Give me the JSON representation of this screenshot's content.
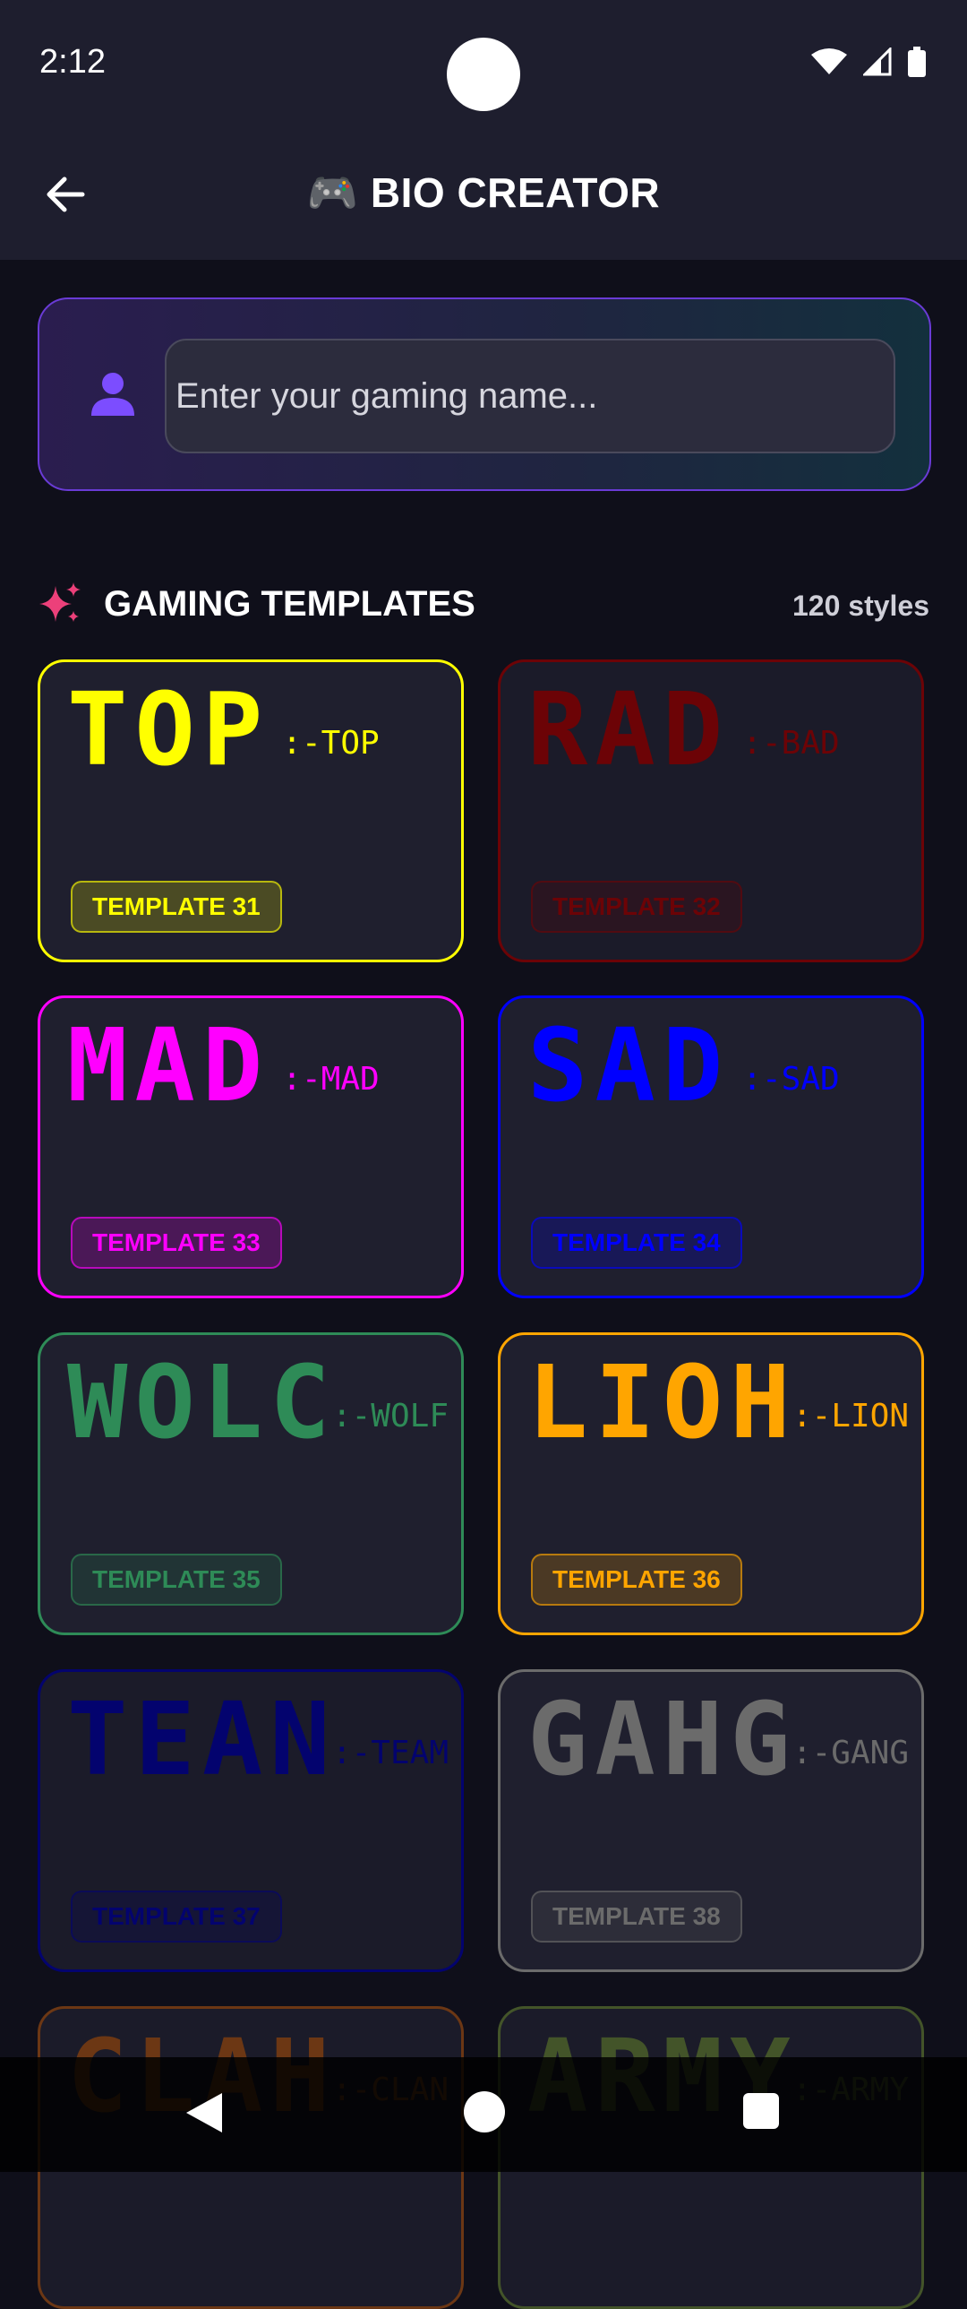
{
  "status": {
    "time": "2:12"
  },
  "appbar": {
    "title": "🎮 BIO CREATOR"
  },
  "name_input": {
    "placeholder": "Enter your gaming name..."
  },
  "section": {
    "title": "GAMING TEMPLATES",
    "count": "120 styles"
  },
  "templates": [
    {
      "word": "TOP",
      "suffix": ":-TOP",
      "label": "TEMPLATE 31",
      "color": "#ffff00",
      "dim": false
    },
    {
      "word": "RAD",
      "suffix": ":-BAD",
      "label": "TEMPLATE 32",
      "color": "#8b0000",
      "dim": true
    },
    {
      "word": "MAD",
      "suffix": ":-MAD",
      "label": "TEMPLATE 33",
      "color": "#ff00ff",
      "dim": false
    },
    {
      "word": "SAD",
      "suffix": ":-SAD",
      "label": "TEMPLATE 34",
      "color": "#0000ff",
      "dim": false
    },
    {
      "word": "WOLC",
      "suffix": ":-WOLF",
      "label": "TEMPLATE 35",
      "color": "#2e8b57",
      "dim": false
    },
    {
      "word": "LIOH",
      "suffix": ":-LION",
      "label": "TEMPLATE 36",
      "color": "#ffa500",
      "dim": false
    },
    {
      "word": "TEAN",
      "suffix": ":-TEAM",
      "label": "TEMPLATE 37",
      "color": "#00008b",
      "dim": true
    },
    {
      "word": "GAHG",
      "suffix": ":-GANG",
      "label": "TEMPLATE 38",
      "color": "#6b6b6b",
      "dim": false
    },
    {
      "word": "CLAH",
      "suffix": ":-CLAN",
      "label": "",
      "color": "#8b4513",
      "dim": true
    },
    {
      "word": "ARMY",
      "suffix": ":-ARMY",
      "label": "",
      "color": "#556b2f",
      "dim": true
    }
  ],
  "colors": {
    "background": "#0f0f1a",
    "appbar": "#1e1e2e",
    "accent": "#6a3bd6",
    "sparkle": "#ec407a"
  }
}
